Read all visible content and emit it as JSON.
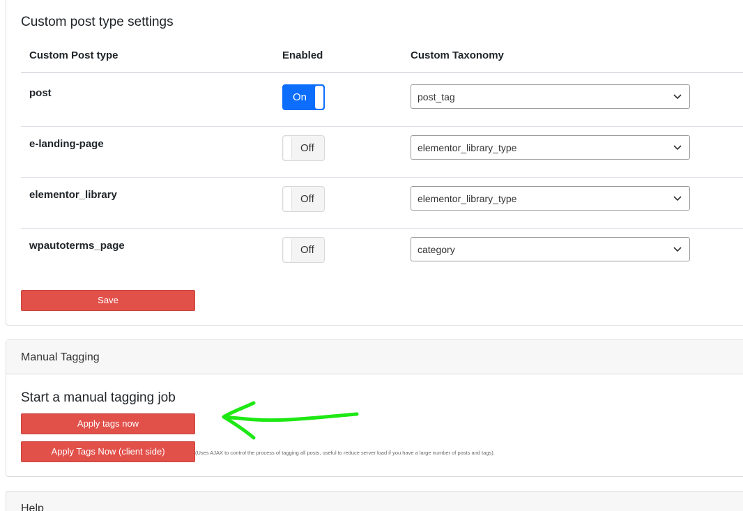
{
  "settings": {
    "title": "Custom post type settings",
    "headers": {
      "post_type": "Custom Post type",
      "enabled": "Enabled",
      "taxonomy": "Custom Taxonomy"
    },
    "rows": [
      {
        "name": "post",
        "toggle": "On",
        "enabled": true,
        "taxonomy": "post_tag"
      },
      {
        "name": "e-landing-page",
        "toggle": "Off",
        "enabled": false,
        "taxonomy": "elementor_library_type"
      },
      {
        "name": "elementor_library",
        "toggle": "Off",
        "enabled": false,
        "taxonomy": "elementor_library_type"
      },
      {
        "name": "wpautoterms_page",
        "toggle": "Off",
        "enabled": false,
        "taxonomy": "category"
      }
    ],
    "save_label": "Save"
  },
  "manual": {
    "header": "Manual Tagging",
    "title": "Start a manual tagging job",
    "apply_label": "Apply tags now",
    "apply_client_label": "Apply Tags Now (client side)",
    "hint": "(Uses AJAX to control the process of tagging all posts, useful to reduce server load if you have a large number of posts and tags)."
  },
  "help": {
    "header": "Help"
  },
  "colors": {
    "accent_red": "#e2504a",
    "toggle_on": "#0d6efd",
    "annotation_arrow": "#1ee814"
  },
  "icons": {
    "select_chevron": "chevron-down-icon",
    "annotation": "arrow-left-icon"
  }
}
